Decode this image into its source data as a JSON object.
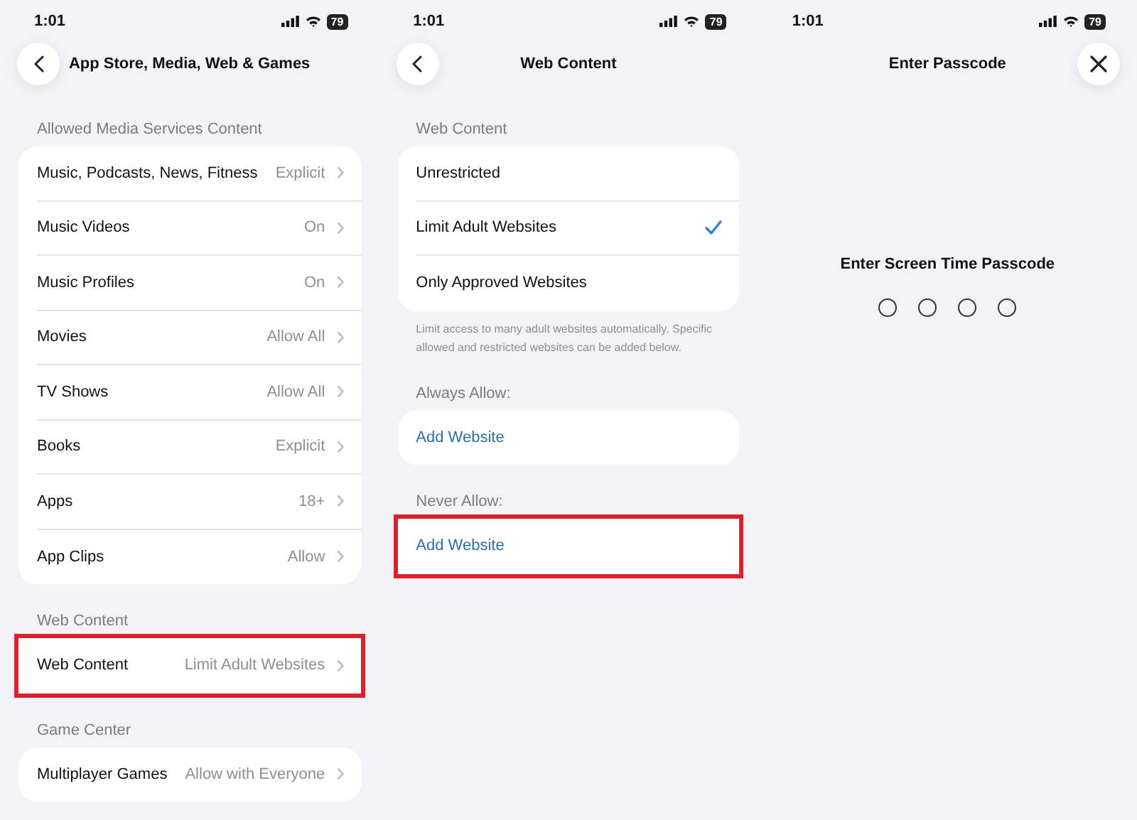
{
  "screens": [
    {
      "kind": "list",
      "time": "1:01",
      "battery": "79",
      "nav": {
        "kind": "back"
      },
      "title": "App Store, Media, Web & Games",
      "sections": [
        {
          "header": "Allowed Media Services Content",
          "highlighted": false,
          "rows": [
            {
              "kind": "disclosure",
              "label": "Music, Podcasts, News, Fitness",
              "value": "Explicit"
            },
            {
              "kind": "disclosure",
              "label": "Music Videos",
              "value": "On"
            },
            {
              "kind": "disclosure",
              "label": "Music Profiles",
              "value": "On"
            },
            {
              "kind": "disclosure",
              "label": "Movies",
              "value": "Allow All"
            },
            {
              "kind": "disclosure",
              "label": "TV Shows",
              "value": "Allow All"
            },
            {
              "kind": "disclosure",
              "label": "Books",
              "value": "Explicit"
            },
            {
              "kind": "disclosure",
              "label": "Apps",
              "value": "18+"
            },
            {
              "kind": "disclosure",
              "label": "App Clips",
              "value": "Allow"
            }
          ]
        },
        {
          "header": "Web Content",
          "highlighted": true,
          "rows": [
            {
              "kind": "disclosure",
              "label": "Web Content",
              "value": "Limit Adult Websites"
            }
          ]
        },
        {
          "header": "Game Center",
          "highlighted": false,
          "rows": [
            {
              "kind": "disclosure",
              "label": "Multiplayer Games",
              "value": "Allow with Everyone"
            }
          ]
        }
      ]
    },
    {
      "kind": "list",
      "time": "1:01",
      "battery": "79",
      "nav": {
        "kind": "back"
      },
      "title": "Web Content",
      "sections": [
        {
          "header": "Web Content",
          "highlighted": false,
          "footer": "Limit access to many adult websites automatically. Specific allowed and restricted websites can be added below.",
          "rows": [
            {
              "kind": "option",
              "label": "Unrestricted",
              "selected": false
            },
            {
              "kind": "option",
              "label": "Limit Adult Websites",
              "selected": true
            },
            {
              "kind": "option",
              "label": "Only Approved Websites",
              "selected": false
            }
          ]
        },
        {
          "header": "Always Allow:",
          "highlighted": false,
          "rows": [
            {
              "kind": "link",
              "label": "Add Website"
            }
          ]
        },
        {
          "header": "Never Allow:",
          "highlighted": true,
          "rows": [
            {
              "kind": "link",
              "label": "Add Website"
            }
          ]
        }
      ]
    },
    {
      "kind": "passcode",
      "time": "1:01",
      "battery": "79",
      "nav": {
        "kind": "close"
      },
      "title": "Enter Passcode",
      "prompt": "Enter Screen Time Passcode",
      "digits": [
        {
          "filled": false
        },
        {
          "filled": false
        },
        {
          "filled": false
        },
        {
          "filled": false
        }
      ]
    }
  ]
}
